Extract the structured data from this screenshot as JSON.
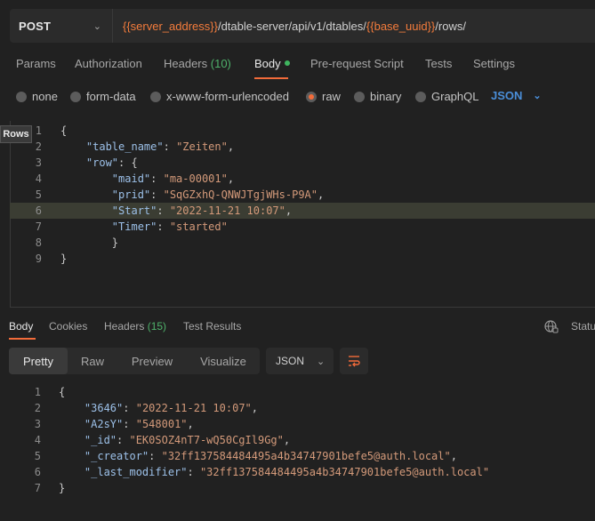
{
  "request": {
    "method": "POST",
    "url_parts": [
      {
        "text": "{{server_address}}",
        "var": true
      },
      {
        "text": "/dtable-server/api/v1/dtables/",
        "var": false
      },
      {
        "text": "{{base_uuid}}",
        "var": true
      },
      {
        "text": "/rows/",
        "var": false
      }
    ]
  },
  "request_tabs": [
    {
      "label": "Params"
    },
    {
      "label": "Authorization"
    },
    {
      "label": "Headers",
      "count": "(10)"
    },
    {
      "label": "Body",
      "active": true
    },
    {
      "label": "Pre-request Script"
    },
    {
      "label": "Tests"
    },
    {
      "label": "Settings"
    }
  ],
  "body_types": [
    "none",
    "form-data",
    "x-www-form-urlencoded",
    "raw",
    "binary",
    "GraphQL"
  ],
  "body_selected": "raw",
  "body_format": "JSON",
  "tooltip": "Rows",
  "request_body": [
    {
      "n": "1",
      "tokens": [
        {
          "t": "{",
          "c": "p"
        }
      ]
    },
    {
      "n": "2",
      "tokens": [
        {
          "t": "    ",
          "c": "p"
        },
        {
          "t": "\"table_name\"",
          "c": "k"
        },
        {
          "t": ": ",
          "c": "p"
        },
        {
          "t": "\"Zeiten\"",
          "c": "s"
        },
        {
          "t": ",",
          "c": "p"
        }
      ]
    },
    {
      "n": "3",
      "tokens": [
        {
          "t": "    ",
          "c": "p"
        },
        {
          "t": "\"row\"",
          "c": "k"
        },
        {
          "t": ": {",
          "c": "p"
        }
      ]
    },
    {
      "n": "4",
      "tokens": [
        {
          "t": "        ",
          "c": "p"
        },
        {
          "t": "\"maid\"",
          "c": "k"
        },
        {
          "t": ": ",
          "c": "p"
        },
        {
          "t": "\"ma-00001\"",
          "c": "s"
        },
        {
          "t": ",",
          "c": "p"
        }
      ]
    },
    {
      "n": "5",
      "tokens": [
        {
          "t": "        ",
          "c": "p"
        },
        {
          "t": "\"prid\"",
          "c": "k"
        },
        {
          "t": ": ",
          "c": "p"
        },
        {
          "t": "\"SqGZxhQ-QNWJTgjWHs-P9A\"",
          "c": "s"
        },
        {
          "t": ",",
          "c": "p"
        }
      ]
    },
    {
      "n": "6",
      "tokens": [
        {
          "t": "        ",
          "c": "p"
        },
        {
          "t": "\"Start\"",
          "c": "k"
        },
        {
          "t": ": ",
          "c": "p"
        },
        {
          "t": "\"2022-11-21 10:07\"",
          "c": "s"
        },
        {
          "t": ",",
          "c": "p"
        }
      ],
      "highlight": true
    },
    {
      "n": "7",
      "tokens": [
        {
          "t": "        ",
          "c": "p"
        },
        {
          "t": "\"Timer\"",
          "c": "k"
        },
        {
          "t": ": ",
          "c": "p"
        },
        {
          "t": "\"started\"",
          "c": "s"
        }
      ]
    },
    {
      "n": "8",
      "tokens": [
        {
          "t": "        }",
          "c": "p"
        }
      ]
    },
    {
      "n": "9",
      "tokens": [
        {
          "t": "}",
          "c": "p"
        }
      ]
    }
  ],
  "response_tabs": [
    {
      "label": "Body",
      "active": true
    },
    {
      "label": "Cookies"
    },
    {
      "label": "Headers",
      "count": "(15)"
    },
    {
      "label": "Test Results"
    }
  ],
  "status_label": "Statu",
  "view_tabs": [
    {
      "label": "Pretty",
      "active": true
    },
    {
      "label": "Raw"
    },
    {
      "label": "Preview"
    },
    {
      "label": "Visualize"
    }
  ],
  "response_format": "JSON",
  "response_body": [
    {
      "n": "1",
      "tokens": [
        {
          "t": "{",
          "c": "p"
        }
      ]
    },
    {
      "n": "2",
      "tokens": [
        {
          "t": "    ",
          "c": "p"
        },
        {
          "t": "\"3646\"",
          "c": "k"
        },
        {
          "t": ": ",
          "c": "p"
        },
        {
          "t": "\"2022-11-21 10:07\"",
          "c": "s"
        },
        {
          "t": ",",
          "c": "p"
        }
      ]
    },
    {
      "n": "3",
      "tokens": [
        {
          "t": "    ",
          "c": "p"
        },
        {
          "t": "\"A2sY\"",
          "c": "k"
        },
        {
          "t": ": ",
          "c": "p"
        },
        {
          "t": "\"548001\"",
          "c": "s"
        },
        {
          "t": ",",
          "c": "p"
        }
      ]
    },
    {
      "n": "4",
      "tokens": [
        {
          "t": "    ",
          "c": "p"
        },
        {
          "t": "\"_id\"",
          "c": "k"
        },
        {
          "t": ": ",
          "c": "p"
        },
        {
          "t": "\"EK0SOZ4nT7-wQ50CgIl9Gg\"",
          "c": "s"
        },
        {
          "t": ",",
          "c": "p"
        }
      ]
    },
    {
      "n": "5",
      "tokens": [
        {
          "t": "    ",
          "c": "p"
        },
        {
          "t": "\"_creator\"",
          "c": "k"
        },
        {
          "t": ": ",
          "c": "p"
        },
        {
          "t": "\"32ff137584484495a4b34747901befe5@auth.local\"",
          "c": "s"
        },
        {
          "t": ",",
          "c": "p"
        }
      ]
    },
    {
      "n": "6",
      "tokens": [
        {
          "t": "    ",
          "c": "p"
        },
        {
          "t": "\"_last_modifier\"",
          "c": "k"
        },
        {
          "t": ": ",
          "c": "p"
        },
        {
          "t": "\"32ff137584484495a4b34747901befe5@auth.local\"",
          "c": "s"
        }
      ]
    },
    {
      "n": "7",
      "tokens": [
        {
          "t": "}",
          "c": "p"
        }
      ]
    }
  ],
  "icons": {
    "method_dropdown": "chevron-down-icon",
    "format_dropdown": "chevron-down-icon",
    "wrap": "wrap-lines-icon",
    "globe": "globe-icon"
  },
  "colors": {
    "accent": "#f26b3a",
    "variable": "#f47c3c",
    "count": "#4fb26b",
    "json_key": "#9cc0e8",
    "json_string": "#d49a7a"
  }
}
